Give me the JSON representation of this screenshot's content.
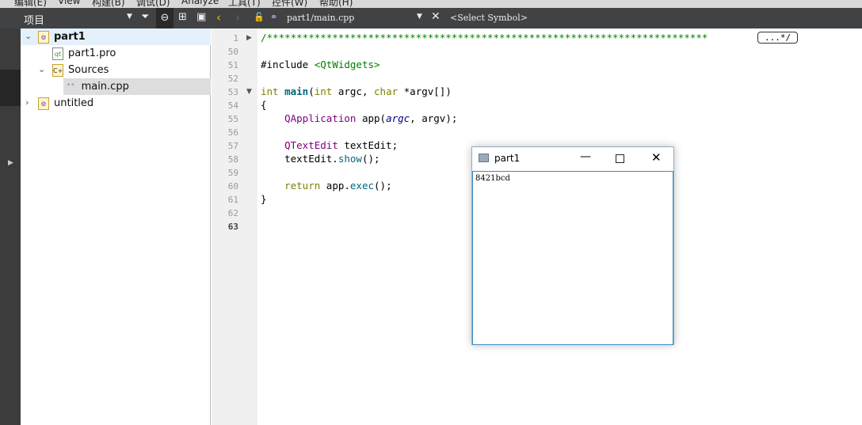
{
  "menu": [
    "编辑(E)",
    "View",
    "构建(B)",
    "调试(D)",
    "Analyze",
    "工具(T)",
    "控件(W)",
    "帮助(H)"
  ],
  "toolbar": {
    "project_combo": "项目",
    "file_combo": "part1/main.cpp",
    "symbol_combo": "<Select Symbol>"
  },
  "tree": [
    {
      "label": "part1",
      "bold": true
    },
    {
      "label": "part1.pro"
    },
    {
      "label": "Sources"
    },
    {
      "label": "main.cpp"
    },
    {
      "label": "untitled"
    }
  ],
  "editor": {
    "line_numbers": [
      "1",
      "50",
      "51",
      "52",
      "53",
      "54",
      "55",
      "56",
      "57",
      "58",
      "59",
      "60",
      "61",
      "62",
      "63"
    ],
    "folded_marker": "...*/"
  },
  "dialog": {
    "title": "part1",
    "text": "8421bcd"
  }
}
